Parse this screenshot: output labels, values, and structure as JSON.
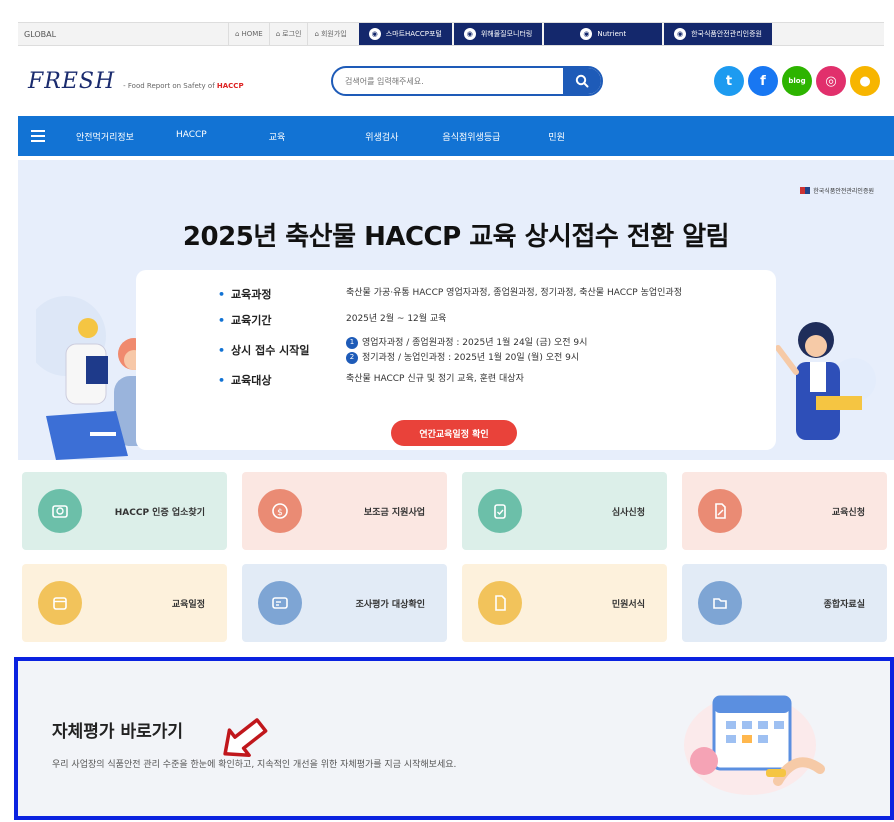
{
  "topbar": {
    "global": "GLOBAL",
    "util": [
      {
        "icon": "home-icon",
        "label": "HOME"
      },
      {
        "icon": "login-icon",
        "label": "로그인"
      },
      {
        "icon": "user-icon",
        "label": "회원가입"
      }
    ],
    "portals": [
      "스마트HACCP포털",
      "위해물질모니터링",
      "Nutrient",
      "한국식품안전관리인증원"
    ]
  },
  "header": {
    "brand": "FRESH",
    "tagline_prefix": "- Food Report on Safety of",
    "tagline_accent": "HACCP",
    "search_placeholder": "검색어를 입력해주세요.",
    "socials": [
      {
        "icon": "twitter-icon",
        "glyph": "t",
        "color": "#1d9bf0"
      },
      {
        "icon": "facebook-icon",
        "glyph": "f",
        "color": "#1877f2"
      },
      {
        "icon": "blog-icon",
        "glyph": "blog",
        "color": "#2db400"
      },
      {
        "icon": "instagram-icon",
        "glyph": "◎",
        "color": "#e1306c"
      },
      {
        "icon": "kakao-icon",
        "glyph": "●",
        "color": "#f7b500"
      }
    ]
  },
  "nav": {
    "items": [
      "안전먹거리정보",
      "HACCP",
      "교육",
      "위생검사",
      "음식점위생등급",
      "민원"
    ]
  },
  "banner": {
    "agency": "한국식품안전관리인증원",
    "title": "2025년 축산물 HACCP 교육 상시접수 전환 알림",
    "rows": [
      {
        "k": "교육과정",
        "v": "축산물 가공·유통 HACCP 영업자과정, 종업원과정, 정기과정, 축산물 HACCP 농업인과정"
      },
      {
        "k": "교육기간",
        "v": "2025년 2월 ~ 12월 교육"
      },
      {
        "k": "상시 접수 시작일",
        "v1": "영업자과정 / 종업원과정 : 2025년 1월 24일 (금) 오전 9시",
        "v2": "정기과정 / 농업인과정 : 2025년 1월 20일 (월) 오전 9시"
      },
      {
        "k": "교육대상",
        "v": "축산물 HACCP 신규 및 정기 교육, 훈련 대상자"
      }
    ],
    "cta": "연간교육일정 확인"
  },
  "tiles": [
    {
      "label": "HACCP 인증 업소찾기",
      "bg": "#dcefe9",
      "circle": "#6cbfa9",
      "icon": "store-search-icon"
    },
    {
      "label": "보조금 지원사업",
      "bg": "#fbe7e2",
      "circle": "#ea8b74",
      "icon": "coin-icon"
    },
    {
      "label": "심사신청",
      "bg": "#dcefe9",
      "circle": "#6cbfa9",
      "icon": "clipboard-icon"
    },
    {
      "label": "교육신청",
      "bg": "#fbe7e2",
      "circle": "#ea8b74",
      "icon": "document-pen-icon"
    },
    {
      "label": "교육일정",
      "bg": "#fdf1dc",
      "circle": "#f2c35b",
      "icon": "calendar-icon"
    },
    {
      "label": "조사평가 대상확인",
      "bg": "#e2ebf6",
      "circle": "#7ea5d4",
      "icon": "id-card-icon"
    },
    {
      "label": "민원서식",
      "bg": "#fdf1dc",
      "circle": "#f2c35b",
      "icon": "form-icon"
    },
    {
      "label": "종합자료실",
      "bg": "#e2ebf6",
      "circle": "#7ea5d4",
      "icon": "folder-icon"
    }
  ],
  "self": {
    "title": "자체평가 바로가기",
    "desc": "우리 사업장의 식품안전 관리 수준을 한눈에 확인하고, 지속적인 개선을 위한 자체평가를 지금 시작해보세요."
  }
}
